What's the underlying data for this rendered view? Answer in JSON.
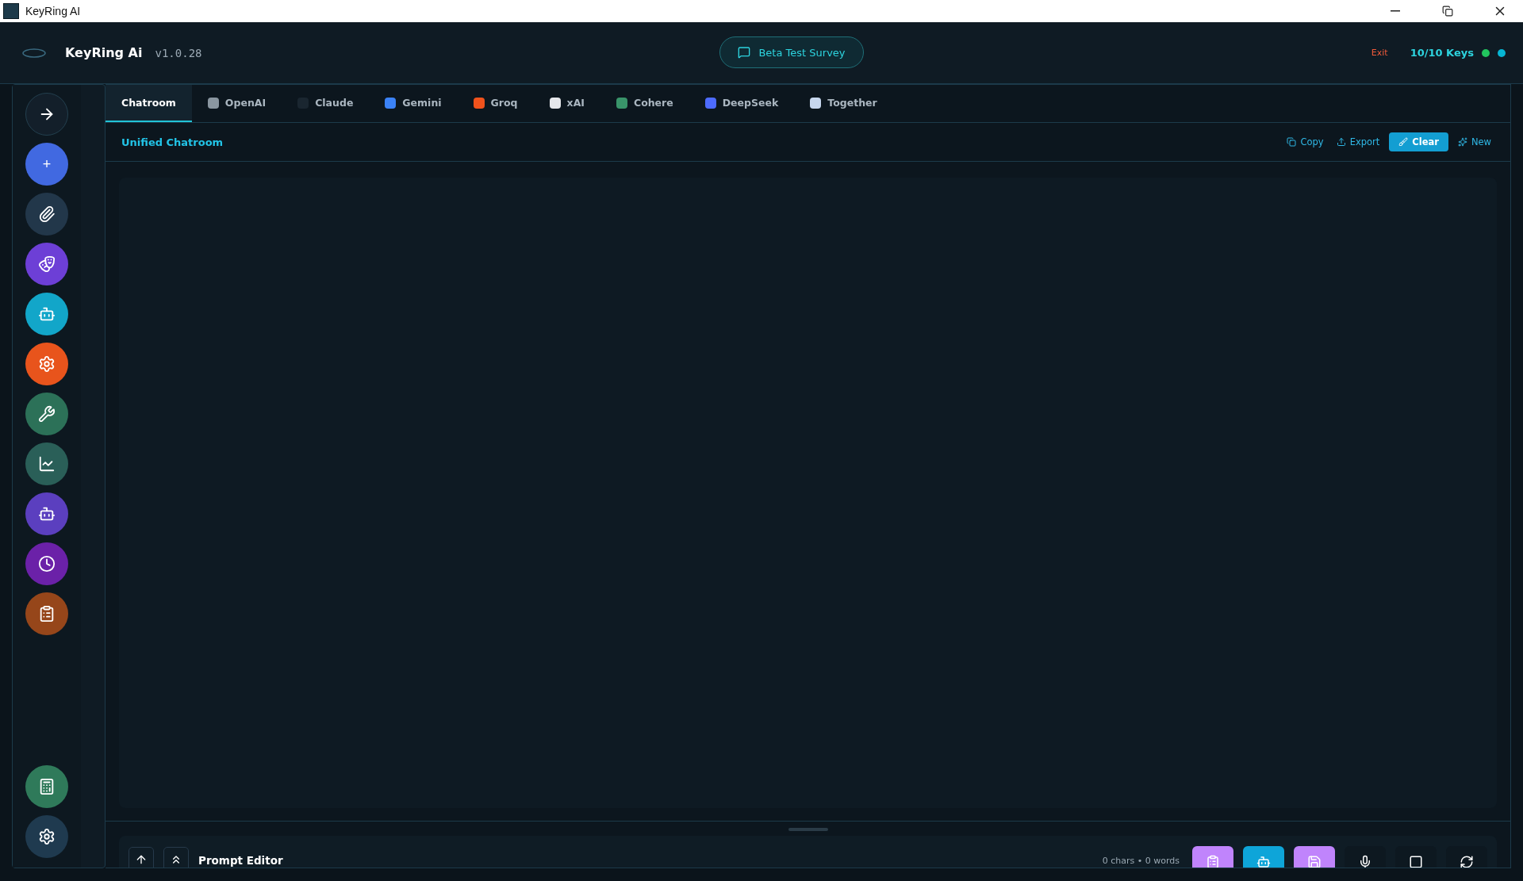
{
  "window": {
    "title": "KeyRing AI"
  },
  "header": {
    "app_name": "KeyRing Ai",
    "version": "v1.0.28",
    "survey_button": "Beta Test Survey",
    "exit": "Exit",
    "keys": "10/10 Keys",
    "status_dots": [
      {
        "color": "#22c55e"
      },
      {
        "color": "#06b6d4"
      }
    ]
  },
  "sidebar": {
    "items": [
      {
        "kind": "arrow",
        "color": "#131f2a"
      },
      {
        "kind": "plus",
        "label": "+",
        "color": "#4169e1"
      },
      {
        "kind": "clip",
        "color": "#22374a"
      },
      {
        "kind": "masks",
        "color": "#6d3fd6"
      },
      {
        "kind": "robot",
        "color": "#12a6c9"
      },
      {
        "kind": "gear",
        "color": "#e8541c"
      },
      {
        "kind": "tools",
        "color": "#2c7158"
      },
      {
        "kind": "chart",
        "color": "#2a5f58"
      },
      {
        "kind": "bot",
        "color": "#5b3fbf"
      },
      {
        "kind": "clock",
        "color": "#6b21a8"
      },
      {
        "kind": "clipboard",
        "color": "#96461a"
      }
    ],
    "bottom_items": [
      {
        "kind": "calculator",
        "color": "#2f7a5a"
      },
      {
        "kind": "gear",
        "color": "#1f3a4f"
      }
    ]
  },
  "tabs": [
    {
      "label": "Chatroom",
      "selected": true,
      "kind": "room"
    },
    {
      "label": "OpenAI",
      "selected": false,
      "kind": "knot"
    },
    {
      "label": "Claude",
      "selected": false,
      "kind": "ring"
    },
    {
      "label": "Gemini",
      "selected": false,
      "kind": "star"
    },
    {
      "label": "Groq",
      "selected": false,
      "kind": "bolt"
    },
    {
      "label": "xAI",
      "selected": false,
      "kind": "slash"
    },
    {
      "label": "Cohere",
      "selected": false,
      "kind": "blob"
    },
    {
      "label": "DeepSeek",
      "selected": false,
      "kind": "whale"
    },
    {
      "label": "Together",
      "selected": false,
      "kind": "grid"
    }
  ],
  "chat": {
    "title": "Unified Chatroom",
    "actions": [
      {
        "label": "Copy",
        "kind": "copy",
        "primary": false
      },
      {
        "label": "Export",
        "kind": "export",
        "primary": false
      },
      {
        "label": "Clear",
        "kind": "clear",
        "primary": true
      },
      {
        "label": "New",
        "kind": "new",
        "primary": false
      }
    ]
  },
  "prompt": {
    "title": "Prompt Editor",
    "counter": "0 chars • 0 words",
    "tools": [
      {
        "kind": "clipboard",
        "color": "#c084fc"
      },
      {
        "kind": "robot",
        "color": "#0ea5d9"
      },
      {
        "kind": "save",
        "color": "#c084fc"
      },
      {
        "kind": "mic",
        "color": "#0d1820"
      },
      {
        "kind": "stop",
        "color": "#0d1820"
      },
      {
        "kind": "refresh",
        "color": "#0d1820"
      }
    ]
  }
}
